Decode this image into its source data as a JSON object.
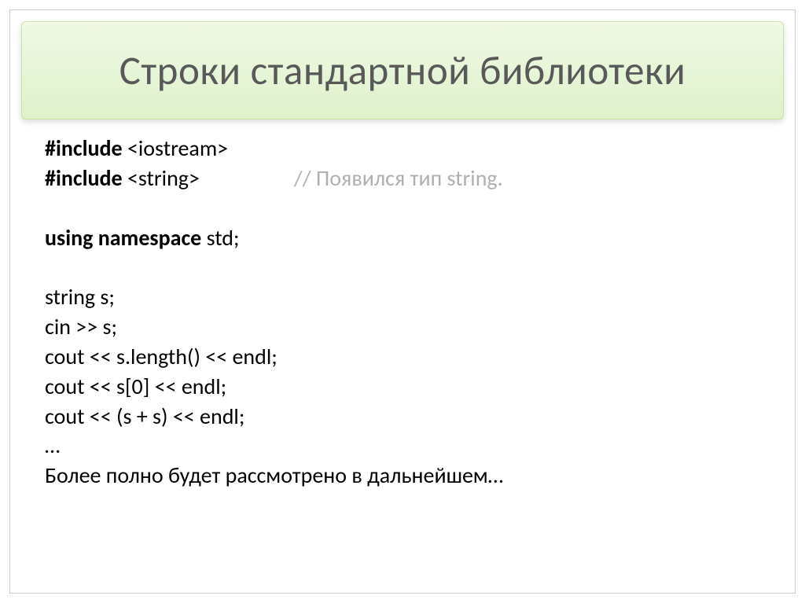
{
  "title": "Строки стандартной библиотеки",
  "code": {
    "line1_keyword": "#include",
    "line1_rest": " <iostream>",
    "line2_keyword": "#include",
    "line2_rest": " <string>",
    "line2_comment": "// Появился тип string.",
    "line3_keyword": "using namespace",
    "line3_rest": " std;",
    "line4": "string s;",
    "line5": "cin >> s;",
    "line6": "cout << s.length() << endl;",
    "line7": "cout << s[0] << endl;",
    "line8": "cout << (s + s) << endl;",
    "line9": "…",
    "line10": "Более полно будет рассмотрено в дальнейшем…"
  }
}
